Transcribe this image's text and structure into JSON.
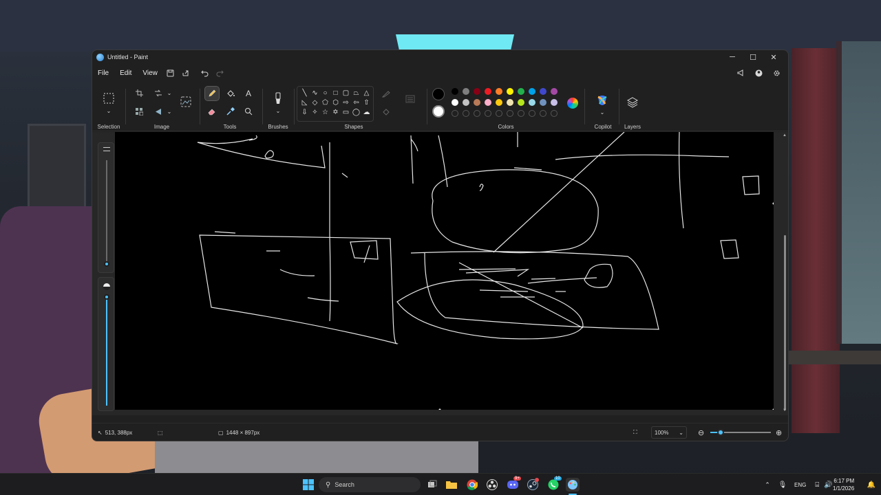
{
  "window": {
    "title": "Untitled - Paint",
    "minimize_label": "─",
    "maximize_label": "☐",
    "close_label": "✕"
  },
  "menu": {
    "file": "File",
    "edit": "Edit",
    "view": "View"
  },
  "ribbon": {
    "groups": {
      "selection": "Selection",
      "image": "Image",
      "tools": "Tools",
      "brushes": "Brushes",
      "shapes": "Shapes",
      "colors": "Colors",
      "copilot": "Copilot",
      "layers": "Layers"
    },
    "text_tool_glyph": "A",
    "colors": {
      "color1": "#000000",
      "color2": "#ffffff",
      "palette_row1": [
        "#000000",
        "#7f7f7f",
        "#880015",
        "#ed1c24",
        "#ff7f27",
        "#fff200",
        "#22b14c",
        "#00a2e8",
        "#3f48cc",
        "#a349a4"
      ],
      "palette_row2": [
        "#ffffff",
        "#c3c3c3",
        "#b97a57",
        "#ffaec9",
        "#ffc90e",
        "#efe4b0",
        "#b5e61d",
        "#99d9ea",
        "#7092be",
        "#c8bfe7"
      ]
    }
  },
  "status": {
    "cursor_position": "513, 388px",
    "canvas_size": "1448 × 897px",
    "zoom": "100%",
    "zoom_out": "⊖",
    "zoom_in": "⊕"
  },
  "taskbar": {
    "search_placeholder": "Search",
    "language": "ENG",
    "time": "6:17 PM",
    "date": "1/1/2026",
    "discord_badge": "9+",
    "whatsapp_badge": "10"
  }
}
